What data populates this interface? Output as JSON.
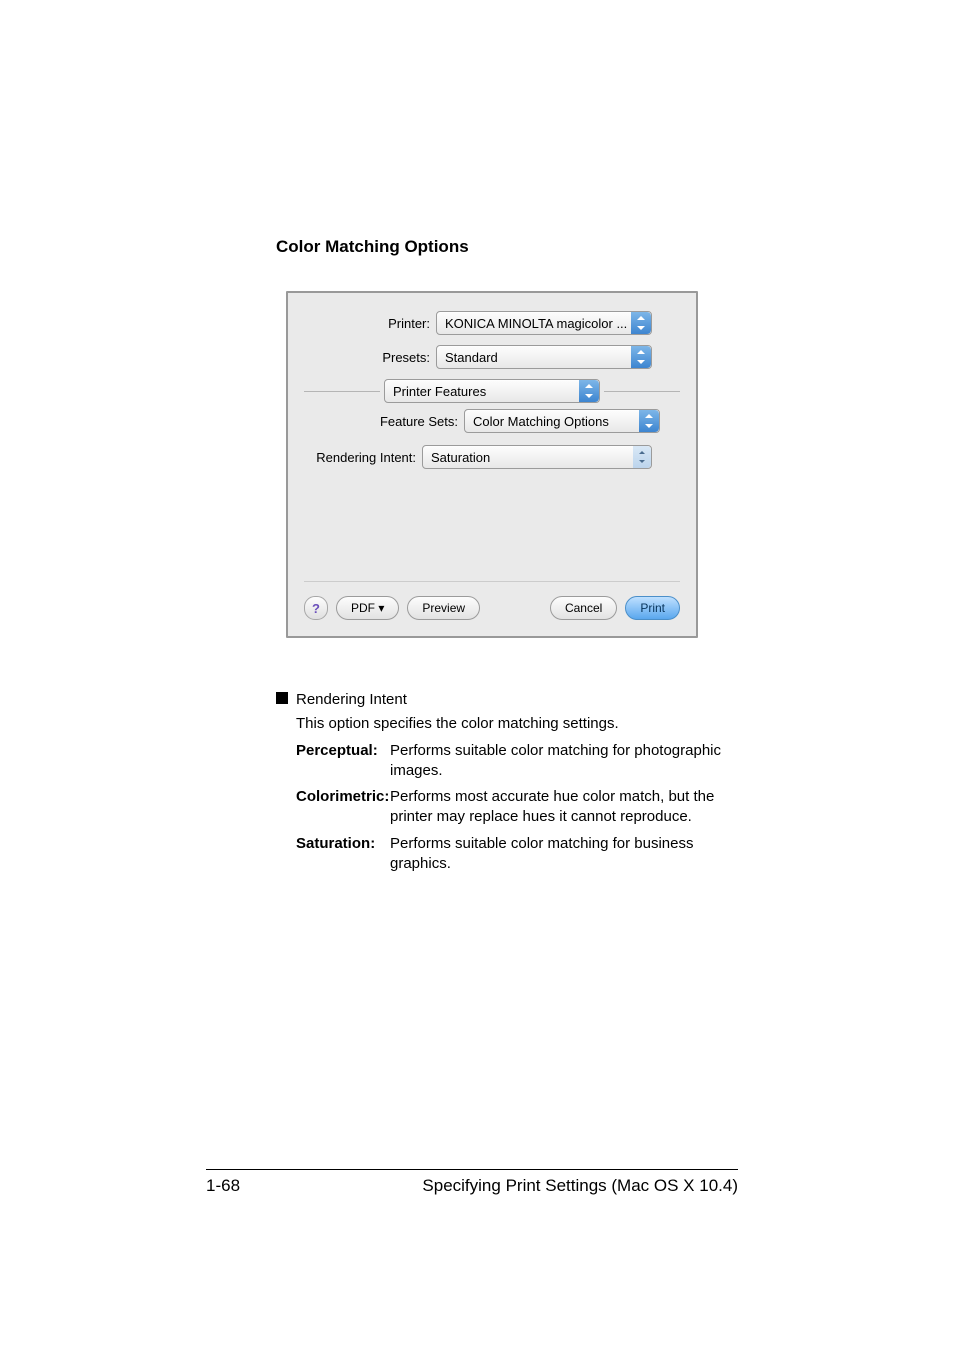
{
  "section_title": "Color Matching Options",
  "dialog": {
    "printer_label": "Printer:",
    "printer_value": "KONICA MINOLTA magicolor ...",
    "presets_label": "Presets:",
    "presets_value": "Standard",
    "pane_value": "Printer Features",
    "feature_sets_label": "Feature Sets:",
    "feature_sets_value": "Color Matching Options",
    "rendering_intent_label": "Rendering Intent:",
    "rendering_intent_value": "Saturation",
    "help_label": "?",
    "pdf_button": "PDF ▾",
    "preview_button": "Preview",
    "cancel_button": "Cancel",
    "print_button": "Print"
  },
  "body": {
    "bullet_title": "Rendering Intent",
    "bullet_desc": "This option specifies the color matching settings.",
    "defs": [
      {
        "term": "Perceptual",
        "body": "Performs suitable color matching for photographic images."
      },
      {
        "term": "Colorimetric",
        "body": "Performs most accurate hue color match, but the printer may replace hues it cannot reproduce."
      },
      {
        "term": "Saturation",
        "body": "Performs suitable color matching for business graphics."
      }
    ]
  },
  "footer": {
    "page": "1-68",
    "title": "Specifying Print Settings (Mac OS X 10.4)"
  }
}
